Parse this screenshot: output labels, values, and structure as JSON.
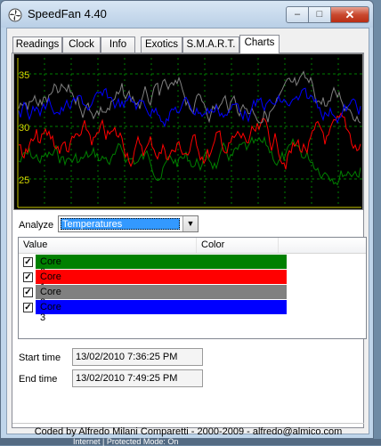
{
  "window": {
    "title": "SpeedFan 4.40",
    "minimize": "–",
    "maximize": "□",
    "close": "✕"
  },
  "tabs": [
    {
      "label": "Readings",
      "active": false
    },
    {
      "label": "Clock",
      "active": false
    },
    {
      "label": "Info",
      "active": false
    },
    {
      "label": "Exotics",
      "active": false
    },
    {
      "label": "S.M.A.R.T.",
      "active": false
    },
    {
      "label": "Charts",
      "active": true
    }
  ],
  "chart": {
    "ytick_labels": [
      "35",
      "30",
      "25"
    ],
    "background": "#000000",
    "grid_color": "#008000",
    "axis_color": "#e0e000"
  },
  "analyze": {
    "label": "Analyze",
    "selected": "Temperatures"
  },
  "list": {
    "columns": [
      "Value",
      "Color"
    ],
    "rows": [
      {
        "label": "Core 0",
        "checked": true,
        "color": "#008000"
      },
      {
        "label": "Core 1",
        "checked": true,
        "color": "#ff0000"
      },
      {
        "label": "Core 2",
        "checked": true,
        "color": "#808080"
      },
      {
        "label": "Core 3",
        "checked": true,
        "color": "#0000ff"
      }
    ]
  },
  "start_time": {
    "label": "Start time",
    "value": "13/02/2010 7:36:25 PM"
  },
  "end_time": {
    "label": "End time",
    "value": "13/02/2010 7:49:25 PM"
  },
  "footer": "Coded by Alfredo Milani Comparetti - 2000-2009 - alfredo@almico.com",
  "background_text": "Internet | Protected Mode: On"
}
